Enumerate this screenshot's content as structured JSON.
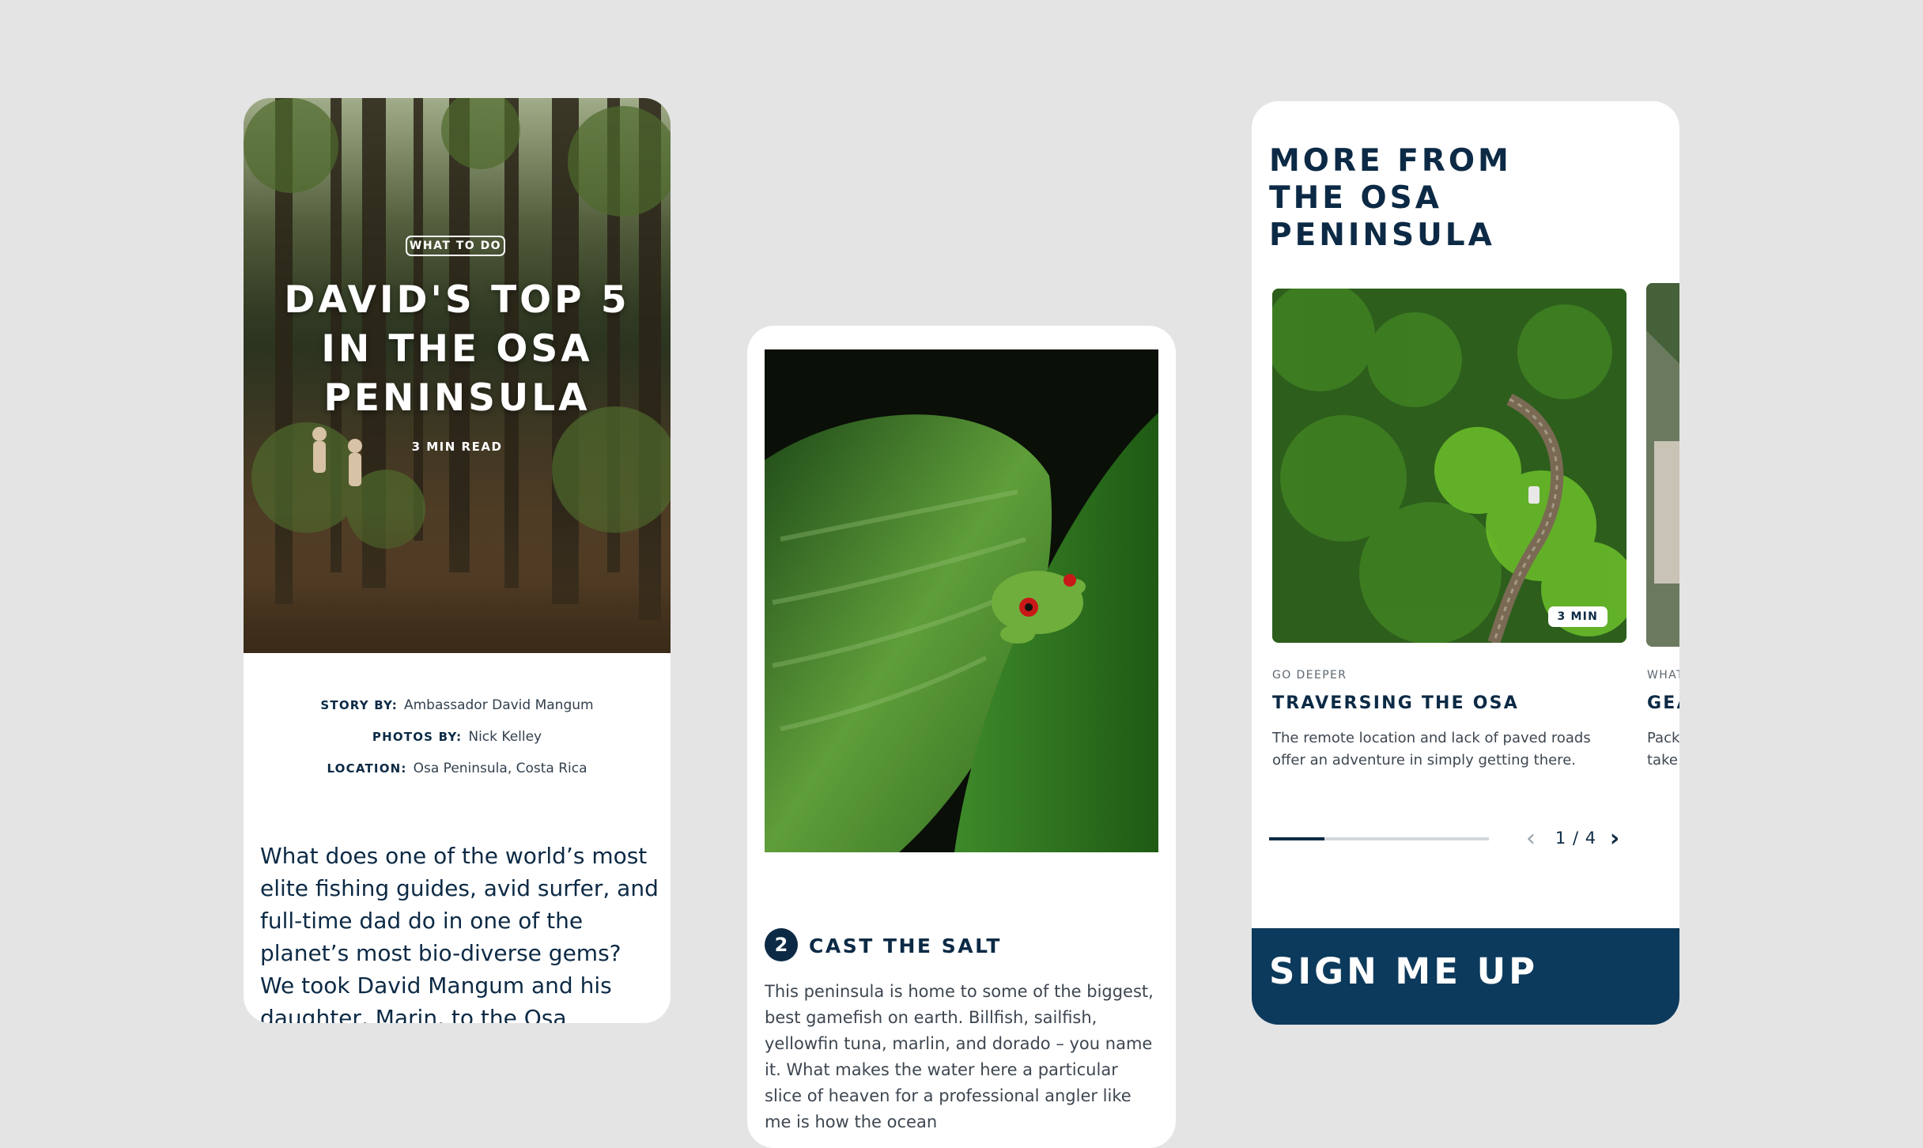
{
  "article": {
    "tag": "WHAT TO DO",
    "title": "DAVID'S TOP 5\nIN THE OSA\nPENINSULA",
    "read_time": "3 MIN READ",
    "credits": [
      {
        "key": "STORY BY:",
        "value": "Ambassador David Mangum"
      },
      {
        "key": "PHOTOS BY:",
        "value": "Nick Kelley"
      },
      {
        "key": "LOCATION:",
        "value": "Osa Peninsula, Costa Rica"
      }
    ],
    "intro": "What does one of the world’s most elite fishing guides, avid surfer, and full-time dad do in one of the planet’s most bio-diverse gems? We took David Mangum and his daughter, Marin, to the Osa"
  },
  "step": {
    "number": "2",
    "title": "CAST THE SALT",
    "body": "This peninsula is home to some of the biggest, best gamefish on earth. Billfish, sailfish, yellowfin tuna, marlin, and dorado – you name it. What makes the water here a particular slice of heaven for a professional angler like me is how the ocean"
  },
  "more": {
    "title": "MORE FROM\nTHE OSA\nPENINSULA",
    "slide": {
      "badge": "3 MIN",
      "kicker": "GO DEEPER",
      "title": "TRAVERSING THE OSA",
      "description": "The remote location and lack of paved roads offer an adventure in simply getting there."
    },
    "next_slide": {
      "kicker": "WHAT",
      "title": "GEA",
      "description": "Pack\ntake."
    },
    "progress": 0.25,
    "pager": {
      "count": "1 / 4",
      "prev_icon": "chevron-left-icon",
      "next_icon": "chevron-right-icon"
    },
    "signup_label": "SIGN ME UP"
  },
  "colors": {
    "navy": "#0c2a45",
    "signup_bg": "#0c3a5c",
    "background": "#e4e4e4"
  }
}
